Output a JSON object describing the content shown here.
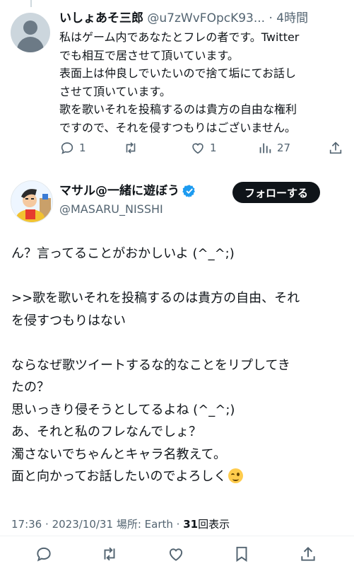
{
  "reply": {
    "name": "いしょあそ三郎",
    "handle": "@u7zWvFOpcK93...",
    "time": "4時間",
    "lines": [
      "私はゲーム内であなたとフレの者です。Twitter",
      "でも相互で居させて頂いています。",
      "表面上は仲良しでいたいので捨て垢にてお話し",
      "させて頂いています。",
      "歌を歌いそれを投稿するのは貴方の自由な権利",
      "ですので、それを侵すつもりはございません。"
    ],
    "reply_count": "1",
    "like_count": "1",
    "view_count": "27"
  },
  "tweet": {
    "name": "マサル@一緒に遊ぼう",
    "handle": "@MASARU_NISSHI",
    "follow_label": "フォローする",
    "lines": [
      "ん？言ってることがおかしいよ (^_^;)",
      "",
      ">>歌を歌いそれを投稿するのは貴方の自由、それ",
      "を侵すつもりはない",
      "",
      "ならなぜ歌ツイートするな的なことをリプしてき",
      "たの？",
      "思いっきり侵そうとしてるよね (^_^;)",
      "あ、それと私のフレなんでしょ？",
      "濁さないでちゃんとキャラ名教えて。",
      "面と向かってお話したいのでよろしく"
    ],
    "time": "17:36",
    "date": "2023/10/31",
    "location_label": "場所:",
    "location": "Earth",
    "view_count": "31",
    "view_label": "回表示"
  },
  "icons": [
    "reply-icon",
    "retweet-icon",
    "like-icon",
    "views-icon",
    "share-icon",
    "bookmark-icon",
    "verified-icon",
    "wink-emoji"
  ],
  "colors": {
    "text": "#0f1419",
    "muted": "#536471",
    "verified": "#1d9bf0",
    "follow_bg": "#0f1419"
  }
}
